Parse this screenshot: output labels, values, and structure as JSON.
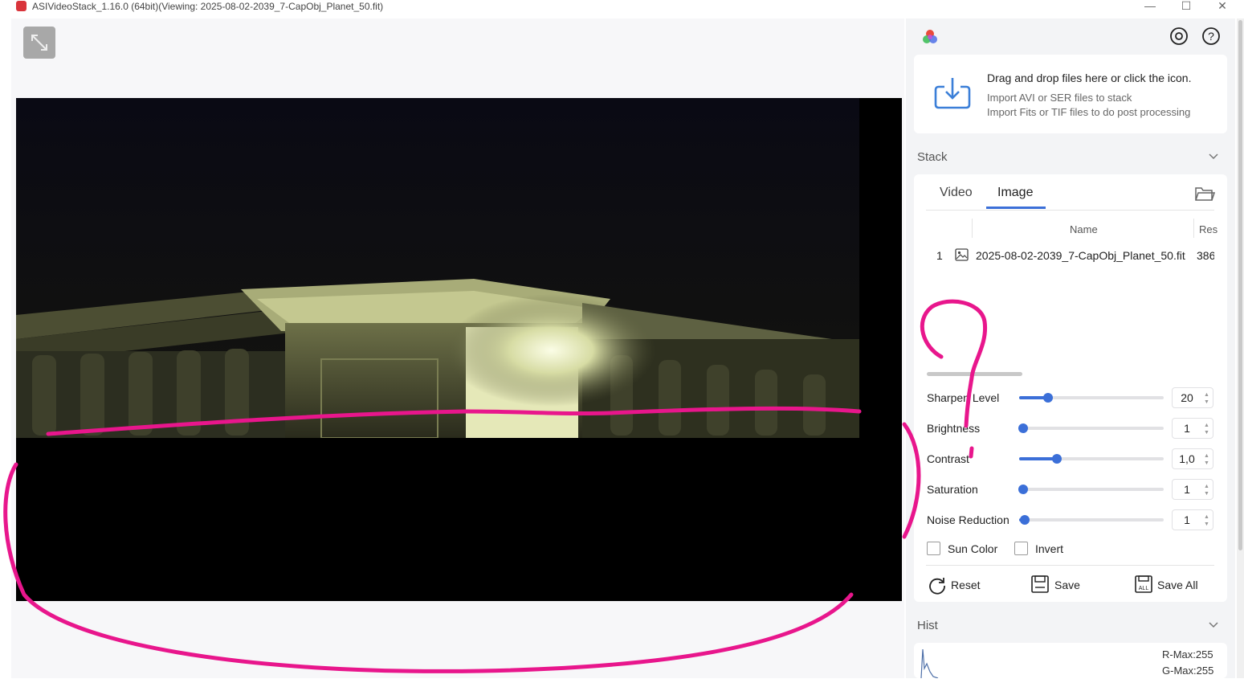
{
  "window": {
    "title": "ASIVideoStack_1.16.0 (64bit)(Viewing: 2025-08-02-2039_7-CapObj_Planet_50.fit)",
    "minimize_glyph": "—",
    "maximize_glyph": "☐",
    "close_glyph": "✕"
  },
  "viewer": {
    "expand_icon": "expand-icon"
  },
  "header": {
    "logo_icon": "rgb-circles-logo",
    "settings_icon": "settings-target-icon",
    "help_icon": "help-icon"
  },
  "import": {
    "icon": "download-icon",
    "main": "Drag and drop files here or click the icon.",
    "line1": "Import AVI or SER files to stack",
    "line2": "Import Fits or TIF files to do post processing"
  },
  "stack": {
    "title": "Stack",
    "tabs": [
      {
        "label": "Video",
        "active": false
      },
      {
        "label": "Image",
        "active": true
      }
    ],
    "columns": [
      "Name",
      "Res"
    ],
    "rows": [
      {
        "index": "1",
        "name": "2025-08-02-2039_7-CapObj_Planet_50.fit",
        "res": "386"
      }
    ]
  },
  "adjustments": [
    {
      "label": "Sharpen Level",
      "value": "20",
      "fraction": 0.2
    },
    {
      "label": "Brightness",
      "value": "1",
      "fraction": 0.03
    },
    {
      "label": "Contrast",
      "value": "1,0",
      "fraction": 0.26
    },
    {
      "label": "Saturation",
      "value": "1",
      "fraction": 0.03
    },
    {
      "label": "Noise Reduction",
      "value": "1",
      "fraction": 0.04
    }
  ],
  "checkboxes": [
    {
      "label": "Sun Color",
      "checked": false
    },
    {
      "label": "Invert",
      "checked": false
    }
  ],
  "actions": {
    "reset": "Reset",
    "save": "Save",
    "save_all": "Save All"
  },
  "hist": {
    "title": "Hist",
    "r_max": "R-Max:255",
    "g_max": "G-Max:255"
  },
  "colors": {
    "accent": "#3b6fd8",
    "annotation": "#e8168c"
  }
}
